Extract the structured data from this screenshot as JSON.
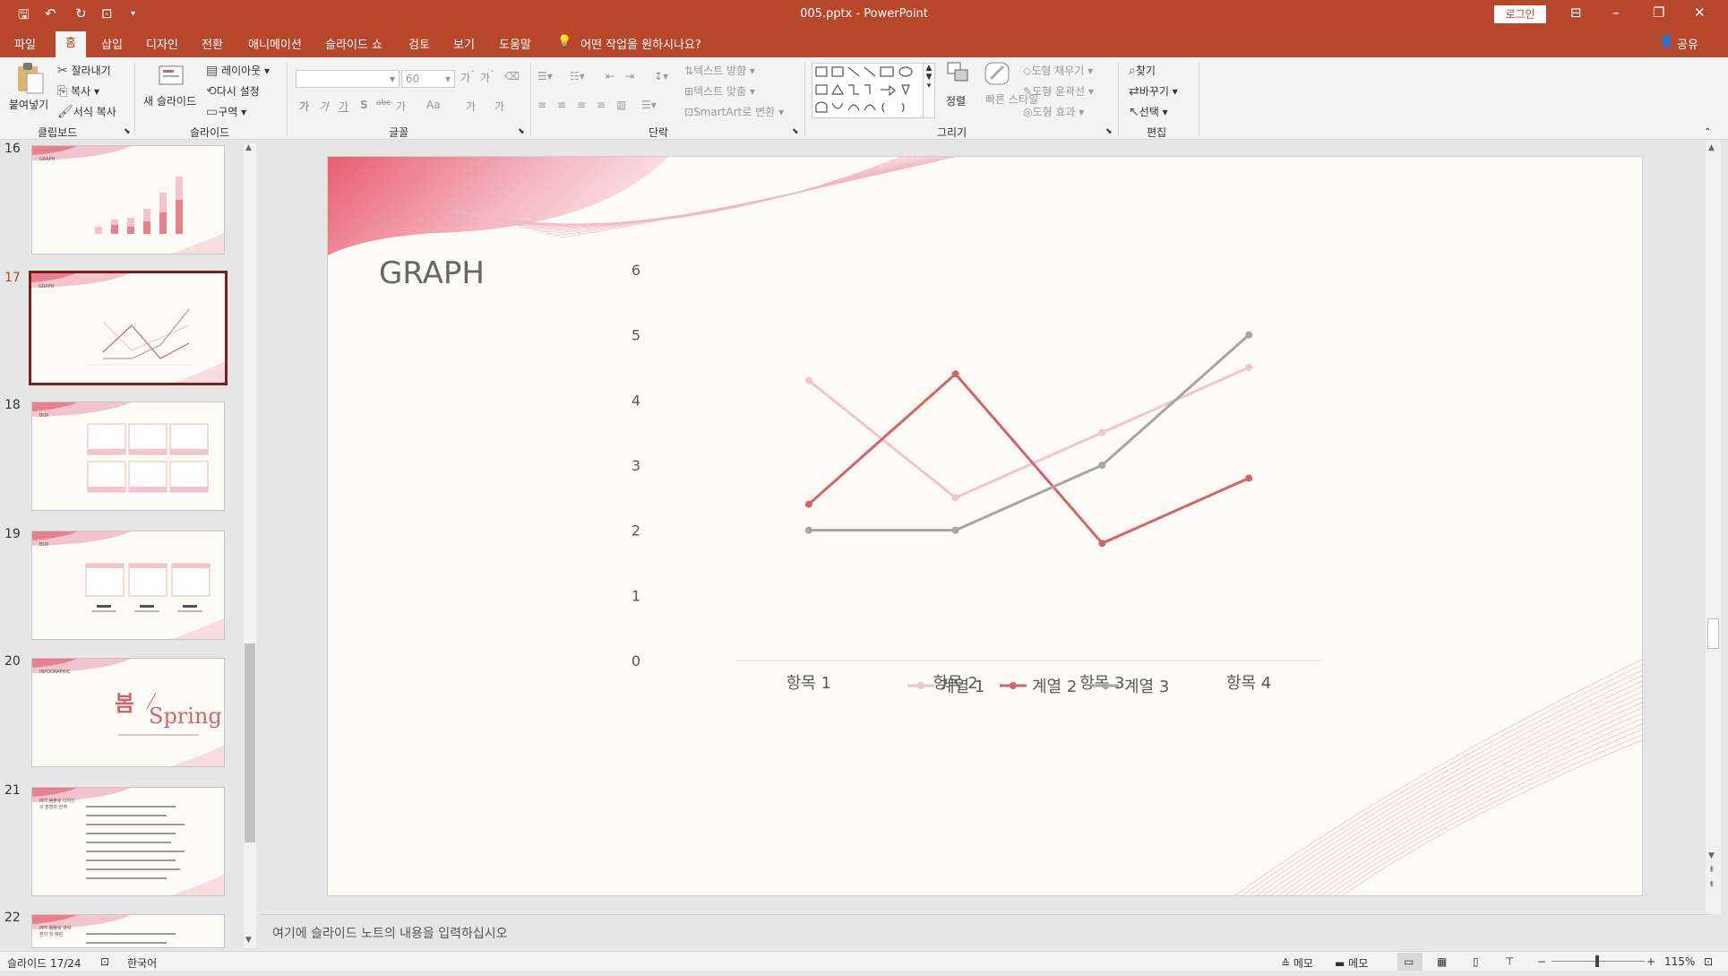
{
  "window": {
    "title": "005.pptx  -  PowerPoint",
    "login": "로그인"
  },
  "quick_access": {
    "save_icon": "save-icon",
    "undo_icon": "undo-icon",
    "redo_icon": "redo-icon",
    "customize_icon": "customize-icon"
  },
  "tabs": [
    "파일",
    "홈",
    "삽입",
    "디자인",
    "전환",
    "애니메이션",
    "슬라이드 쇼",
    "검토",
    "보기",
    "도움말"
  ],
  "tell_me": "어떤 작업을 원하시나요?",
  "share": "공유",
  "ribbon": {
    "clipboard": {
      "paste": "붙여넣기",
      "cut": "잘라내기",
      "copy": "복사",
      "format_painter": "서식 복사",
      "group": "클립보드"
    },
    "slides": {
      "new_slide": "새 슬라이드",
      "layout": "레이아웃",
      "reset": "다시 설정",
      "section": "구역",
      "group": "슬라이드"
    },
    "font": {
      "size": "60",
      "group": "글꼴",
      "buttons": [
        "가",
        "가",
        "가",
        "S",
        "abc",
        "가",
        "Aa",
        "가",
        "가"
      ]
    },
    "paragraph": {
      "text_direction": "텍스트 방향",
      "align_text": "텍스트 맞춤",
      "smartart": "SmartArt로 변환",
      "group": "단락"
    },
    "drawing": {
      "arrange": "정렬",
      "quick_styles": "빠른 스타일",
      "fill": "도형 채우기",
      "outline": "도형 윤곽선",
      "effects": "도형 효과",
      "group": "그리기"
    },
    "editing": {
      "find": "찾기",
      "replace": "바꾸기",
      "select": "선택",
      "group": "편집"
    }
  },
  "thumbnails": [
    {
      "num": "16",
      "title": "GRAPH"
    },
    {
      "num": "17",
      "title": "GRAPH"
    },
    {
      "num": "18",
      "title": "BOX"
    },
    {
      "num": "19",
      "title": "BOX"
    },
    {
      "num": "20",
      "title": "INFOGRAPHIC",
      "big": "봄",
      "script": "Spring"
    },
    {
      "num": "21",
      "title": "PPT 템플릿 디자인의 장점과 한계"
    },
    {
      "num": "22",
      "title": "PPT 템플릿 파워 편리 및 예판"
    }
  ],
  "slide": {
    "title": "GRAPH"
  },
  "chart_data": {
    "type": "line",
    "categories": [
      "항목 1",
      "항목 2",
      "항목 3",
      "항목 4"
    ],
    "series": [
      {
        "name": "계열 1",
        "values": [
          4.3,
          2.5,
          3.5,
          4.5
        ],
        "color": "#f0c5cc"
      },
      {
        "name": "계열 2",
        "values": [
          2.4,
          4.4,
          1.8,
          2.8
        ],
        "color": "#d2646e"
      },
      {
        "name": "계열 3",
        "values": [
          2.0,
          2.0,
          3.0,
          5.0
        ],
        "color": "#a5a5a5"
      }
    ],
    "ylim": [
      0,
      6
    ],
    "yticks": [
      "0",
      "1",
      "2",
      "3",
      "4",
      "5",
      "6"
    ],
    "grid": false,
    "legend": "bottom"
  },
  "notes": "여기에 슬라이드 노트의 내용을 입력하십시오",
  "status": {
    "slide": "슬라이드 17/24",
    "language": "한국어",
    "notes": "메모",
    "comments": "메모",
    "zoom": "115%"
  }
}
